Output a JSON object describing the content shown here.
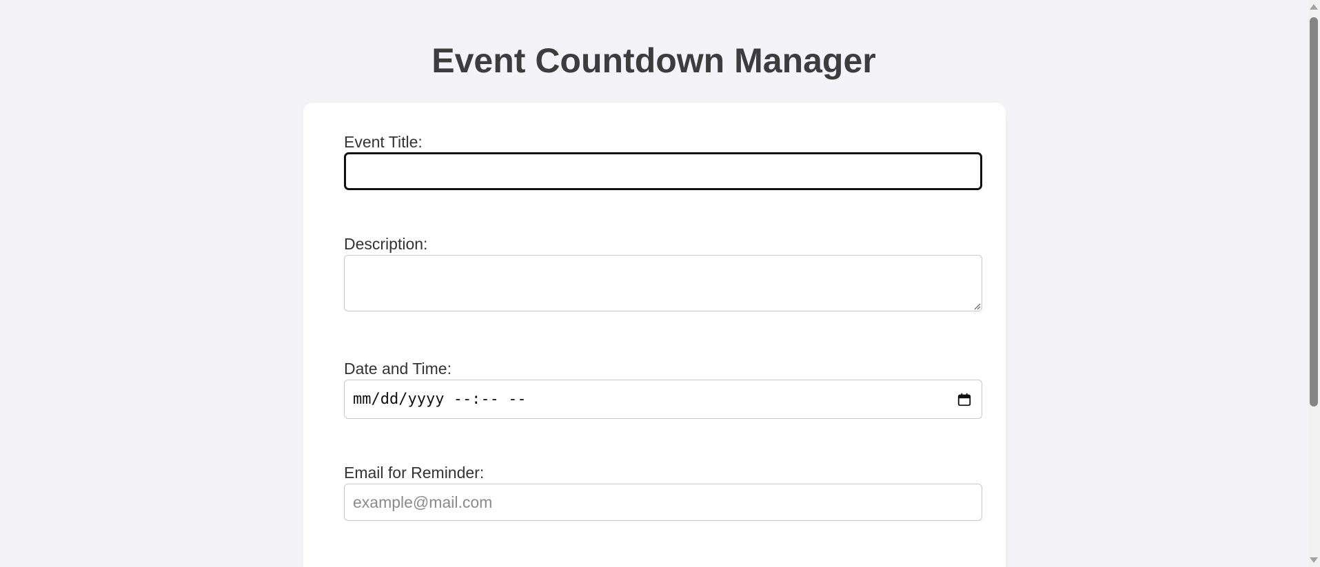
{
  "page": {
    "title": "Event Countdown Manager"
  },
  "form": {
    "event_title": {
      "label": "Event Title:",
      "value": ""
    },
    "description": {
      "label": "Description:",
      "value": ""
    },
    "datetime": {
      "label": "Date and Time:",
      "display": "mm/dd/yyyy --:-- --",
      "icon": "calendar-icon"
    },
    "email": {
      "label": "Email for Reminder:",
      "placeholder": "example@mail.com",
      "value": ""
    }
  },
  "colors": {
    "background": "#f4f4f8",
    "card": "#ffffff",
    "title_text": "#3d3d3d",
    "focus_border": "#111111",
    "input_border": "#c9c9c9"
  }
}
